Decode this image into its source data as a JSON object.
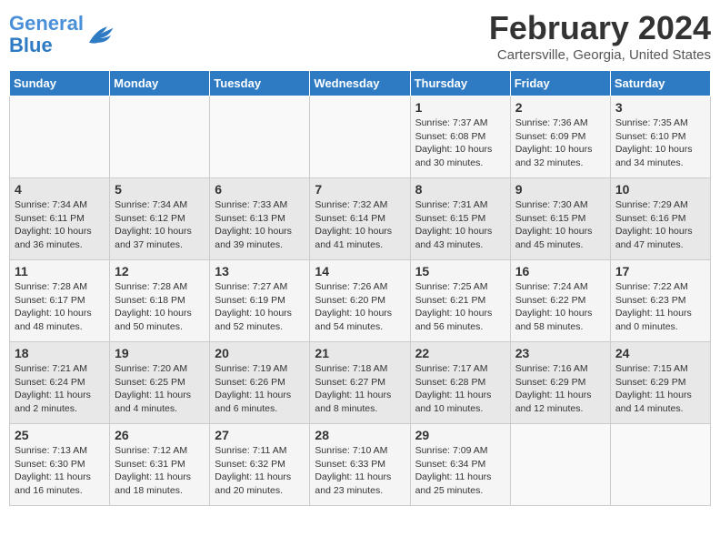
{
  "header": {
    "logo_line1": "General",
    "logo_line2": "Blue",
    "title": "February 2024",
    "subtitle": "Cartersville, Georgia, United States"
  },
  "weekdays": [
    "Sunday",
    "Monday",
    "Tuesday",
    "Wednesday",
    "Thursday",
    "Friday",
    "Saturday"
  ],
  "weeks": [
    [
      {
        "day": "",
        "info": ""
      },
      {
        "day": "",
        "info": ""
      },
      {
        "day": "",
        "info": ""
      },
      {
        "day": "",
        "info": ""
      },
      {
        "day": "1",
        "info": "Sunrise: 7:37 AM\nSunset: 6:08 PM\nDaylight: 10 hours\nand 30 minutes."
      },
      {
        "day": "2",
        "info": "Sunrise: 7:36 AM\nSunset: 6:09 PM\nDaylight: 10 hours\nand 32 minutes."
      },
      {
        "day": "3",
        "info": "Sunrise: 7:35 AM\nSunset: 6:10 PM\nDaylight: 10 hours\nand 34 minutes."
      }
    ],
    [
      {
        "day": "4",
        "info": "Sunrise: 7:34 AM\nSunset: 6:11 PM\nDaylight: 10 hours\nand 36 minutes."
      },
      {
        "day": "5",
        "info": "Sunrise: 7:34 AM\nSunset: 6:12 PM\nDaylight: 10 hours\nand 37 minutes."
      },
      {
        "day": "6",
        "info": "Sunrise: 7:33 AM\nSunset: 6:13 PM\nDaylight: 10 hours\nand 39 minutes."
      },
      {
        "day": "7",
        "info": "Sunrise: 7:32 AM\nSunset: 6:14 PM\nDaylight: 10 hours\nand 41 minutes."
      },
      {
        "day": "8",
        "info": "Sunrise: 7:31 AM\nSunset: 6:15 PM\nDaylight: 10 hours\nand 43 minutes."
      },
      {
        "day": "9",
        "info": "Sunrise: 7:30 AM\nSunset: 6:15 PM\nDaylight: 10 hours\nand 45 minutes."
      },
      {
        "day": "10",
        "info": "Sunrise: 7:29 AM\nSunset: 6:16 PM\nDaylight: 10 hours\nand 47 minutes."
      }
    ],
    [
      {
        "day": "11",
        "info": "Sunrise: 7:28 AM\nSunset: 6:17 PM\nDaylight: 10 hours\nand 48 minutes."
      },
      {
        "day": "12",
        "info": "Sunrise: 7:28 AM\nSunset: 6:18 PM\nDaylight: 10 hours\nand 50 minutes."
      },
      {
        "day": "13",
        "info": "Sunrise: 7:27 AM\nSunset: 6:19 PM\nDaylight: 10 hours\nand 52 minutes."
      },
      {
        "day": "14",
        "info": "Sunrise: 7:26 AM\nSunset: 6:20 PM\nDaylight: 10 hours\nand 54 minutes."
      },
      {
        "day": "15",
        "info": "Sunrise: 7:25 AM\nSunset: 6:21 PM\nDaylight: 10 hours\nand 56 minutes."
      },
      {
        "day": "16",
        "info": "Sunrise: 7:24 AM\nSunset: 6:22 PM\nDaylight: 10 hours\nand 58 minutes."
      },
      {
        "day": "17",
        "info": "Sunrise: 7:22 AM\nSunset: 6:23 PM\nDaylight: 11 hours\nand 0 minutes."
      }
    ],
    [
      {
        "day": "18",
        "info": "Sunrise: 7:21 AM\nSunset: 6:24 PM\nDaylight: 11 hours\nand 2 minutes."
      },
      {
        "day": "19",
        "info": "Sunrise: 7:20 AM\nSunset: 6:25 PM\nDaylight: 11 hours\nand 4 minutes."
      },
      {
        "day": "20",
        "info": "Sunrise: 7:19 AM\nSunset: 6:26 PM\nDaylight: 11 hours\nand 6 minutes."
      },
      {
        "day": "21",
        "info": "Sunrise: 7:18 AM\nSunset: 6:27 PM\nDaylight: 11 hours\nand 8 minutes."
      },
      {
        "day": "22",
        "info": "Sunrise: 7:17 AM\nSunset: 6:28 PM\nDaylight: 11 hours\nand 10 minutes."
      },
      {
        "day": "23",
        "info": "Sunrise: 7:16 AM\nSunset: 6:29 PM\nDaylight: 11 hours\nand 12 minutes."
      },
      {
        "day": "24",
        "info": "Sunrise: 7:15 AM\nSunset: 6:29 PM\nDaylight: 11 hours\nand 14 minutes."
      }
    ],
    [
      {
        "day": "25",
        "info": "Sunrise: 7:13 AM\nSunset: 6:30 PM\nDaylight: 11 hours\nand 16 minutes."
      },
      {
        "day": "26",
        "info": "Sunrise: 7:12 AM\nSunset: 6:31 PM\nDaylight: 11 hours\nand 18 minutes."
      },
      {
        "day": "27",
        "info": "Sunrise: 7:11 AM\nSunset: 6:32 PM\nDaylight: 11 hours\nand 20 minutes."
      },
      {
        "day": "28",
        "info": "Sunrise: 7:10 AM\nSunset: 6:33 PM\nDaylight: 11 hours\nand 23 minutes."
      },
      {
        "day": "29",
        "info": "Sunrise: 7:09 AM\nSunset: 6:34 PM\nDaylight: 11 hours\nand 25 minutes."
      },
      {
        "day": "",
        "info": ""
      },
      {
        "day": "",
        "info": ""
      }
    ]
  ]
}
